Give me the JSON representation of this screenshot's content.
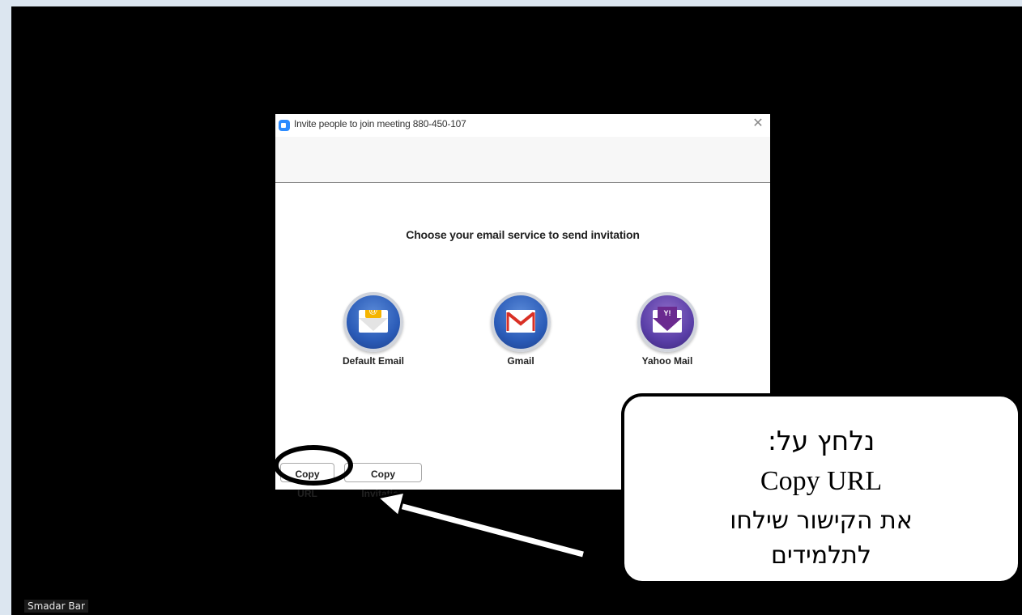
{
  "dialog": {
    "title": "Invite people to join meeting 880-450-107",
    "close_glyph": "✕",
    "heading": "Choose your email service to send invitation",
    "services": [
      {
        "label": "Default Email",
        "icon": "default-email-icon",
        "symbol": "@"
      },
      {
        "label": "Gmail",
        "icon": "gmail-icon",
        "symbol": "M"
      },
      {
        "label": "Yahoo Mail",
        "icon": "yahoo-mail-icon",
        "symbol": "Y!"
      }
    ],
    "buttons": {
      "copy_url": "Copy URL",
      "copy_invitation": "Copy Invitation"
    }
  },
  "callout": {
    "line1": "נלחץ על:",
    "line2": "Copy URL",
    "line3": "את הקישור שילחו",
    "line4": "לתלמידים"
  },
  "participant": {
    "name": "Smadar Bar"
  },
  "colors": {
    "zoom_blue": "#2d8cff",
    "background": "#000000",
    "page_edge": "#dce6f0"
  }
}
